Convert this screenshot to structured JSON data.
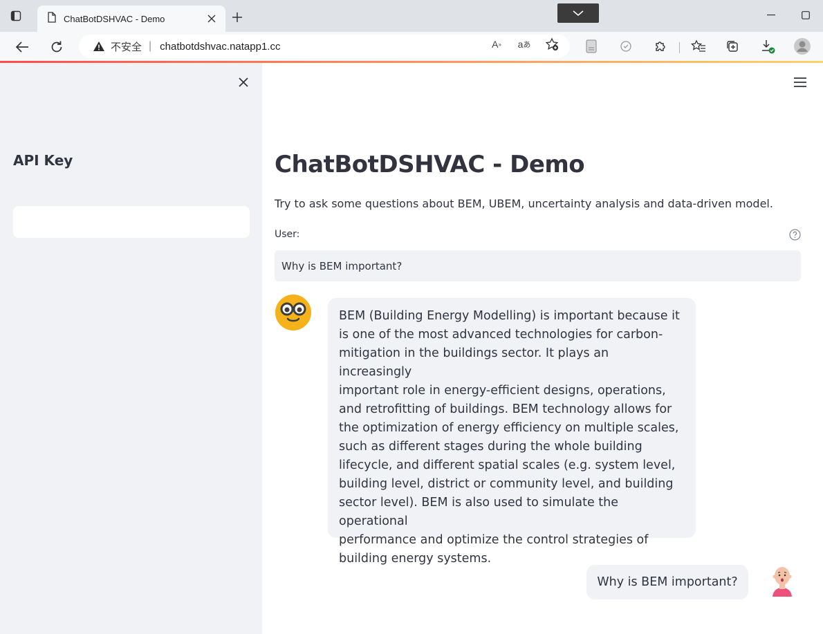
{
  "browser": {
    "tab_title": "ChatBotDSHVAC - Demo",
    "address_security": "不安全",
    "address_url": "chatbotdshvac.natapp1.cc"
  },
  "sidebar": {
    "title": "API Key",
    "api_key_value": ""
  },
  "main": {
    "title": "ChatBotDSHVAC - Demo",
    "subtitle": "Try to ask some questions about BEM, UBEM, uncertainty analysis and data-driven model.",
    "input_label": "User:",
    "input_value": "Why is BEM important?",
    "messages": [
      {
        "role": "bot",
        "lines": [
          "BEM (Building Energy Modelling) is important because it",
          "is one of the most advanced technologies for carbon-",
          "mitigation in the buildings sector. It plays an increasingly",
          "important role in energy-efficient designs, operations,",
          "and retrofitting of buildings. BEM technology allows for",
          "the optimization of energy efficiency on multiple scales,",
          "such as different stages during the whole building",
          "lifecycle, and different spatial scales (e.g. system level,",
          "building level, district or community level, and building",
          "sector level). BEM is also used to simulate the operational",
          "performance and optimize the control strategies of",
          "building energy systems."
        ]
      },
      {
        "role": "user",
        "text": "Why is BEM important?"
      }
    ]
  },
  "colors": {
    "sidebar_bg": "#f0f2f6",
    "bubble_bg": "#f0f2f6",
    "text": "#31333f",
    "bot_avatar": "#f6b21a",
    "user_avatar_shirt": "#ef4f7b"
  },
  "icons": {
    "tab_actions": "tab-actions-icon",
    "page": "page-icon",
    "close": "close-icon",
    "new_tab": "plus-icon",
    "back": "back-arrow-icon",
    "refresh": "refresh-icon",
    "warning": "warning-icon",
    "read_aloud": "read-aloud-icon",
    "translate": "translate-icon",
    "favorite": "add-favorite-icon",
    "reading_view": "reading-view-icon",
    "tracking": "tracking-icon",
    "extensions": "puzzle-icon",
    "favorites": "favorites-icon",
    "collections": "collections-icon",
    "downloads": "download-icon",
    "profile": "profile-icon",
    "menu": "hamburger-icon",
    "help": "help-icon"
  }
}
